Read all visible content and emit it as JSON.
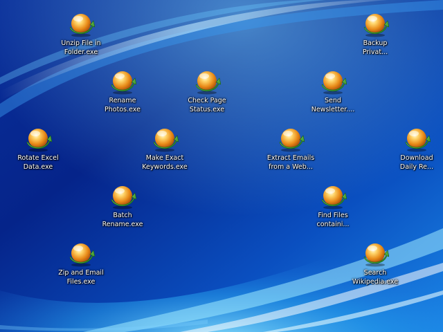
{
  "desktop": {
    "icons": [
      {
        "label": "Unzip File in\nFolder.exe",
        "icon": "app-orb-icon"
      },
      {
        "label": "Backup\nPrivat...",
        "icon": "app-orb-icon"
      },
      {
        "label": "Rename\nPhotos.exe",
        "icon": "app-orb-icon"
      },
      {
        "label": "Check Page\nStatus.exe",
        "icon": "app-orb-icon"
      },
      {
        "label": "Send\nNewsletter....",
        "icon": "app-orb-icon"
      },
      {
        "label": "Rotate Excel\nData.exe",
        "icon": "app-orb-icon"
      },
      {
        "label": "Make Exact\nKeywords.exe",
        "icon": "app-orb-icon"
      },
      {
        "label": "Extract Emails\nfrom a Web...",
        "icon": "app-orb-icon"
      },
      {
        "label": "Download\nDaily Re...",
        "icon": "app-orb-icon"
      },
      {
        "label": "Batch\nRename.exe",
        "icon": "app-orb-icon"
      },
      {
        "label": "Find Files\ncontaini...",
        "icon": "app-orb-icon"
      },
      {
        "label": "Zip and Email\nFiles.exe",
        "icon": "app-orb-icon"
      },
      {
        "label": "Search\nWikipedia.exe",
        "icon": "app-orb-icon"
      }
    ],
    "colors": {
      "wallpaper_dark": "#04207a",
      "wallpaper_mid": "#0a52c8",
      "wallpaper_light": "#3fc4ff",
      "orb_orange": "#f0a020",
      "orb_green": "#3aa83a"
    }
  }
}
